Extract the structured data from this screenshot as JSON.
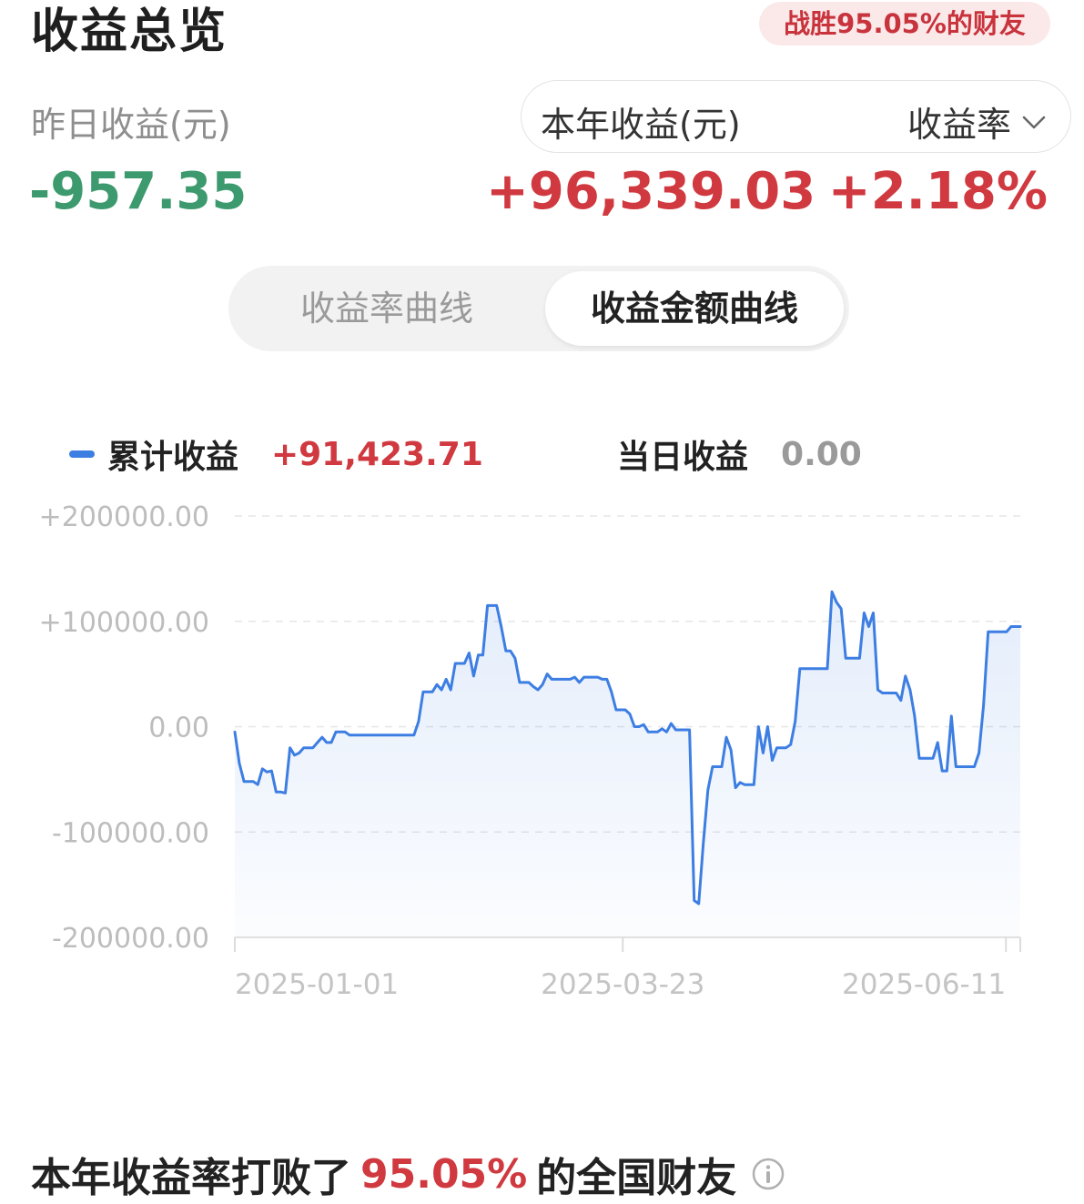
{
  "header": {
    "title": "收益总览",
    "beat_badge": "战胜95.05%的财友"
  },
  "summary": {
    "yesterday_label": "昨日收益(元)",
    "yesterday_value": "-957.35",
    "year_label": "本年收益(元)",
    "year_value": "+96,339.03",
    "rate_select_label": "收益率",
    "rate_value": "+2.18%"
  },
  "tabs": {
    "rate_curve": "收益率曲线",
    "amount_curve": "收益金额曲线",
    "active": "amount_curve"
  },
  "legend": {
    "cumulative_label": "累计收益",
    "cumulative_value": "+91,423.71",
    "daily_label": "当日收益",
    "daily_value": "0.00"
  },
  "colors": {
    "line": "#3d7ee3",
    "positive": "#d0393f",
    "negative": "#3d9a6e"
  },
  "chart_data": {
    "type": "area",
    "ylim": [
      -200000,
      200000
    ],
    "yticks": [
      "+200000.00",
      "+100000.00",
      "0.00",
      "-100000.00",
      "-200000.00"
    ],
    "xticks": [
      "2025-01-01",
      "2025-03-23",
      "2025-06-11"
    ],
    "x_dates": [
      "2025-01-01",
      "2025-06-14"
    ],
    "grid": true,
    "series": [
      {
        "values": [
          -5000,
          -35000,
          -52000,
          -52000,
          -52000,
          -55000,
          -40000,
          -43000,
          -42000,
          -62000,
          -62000,
          -63000,
          -20000,
          -27000,
          -25000,
          -20000,
          -20000,
          -20000,
          -15000,
          -10000,
          -15000,
          -15000,
          -5000,
          -5000,
          -5000,
          -8000,
          -8000,
          -8000,
          -8000,
          -8000,
          -8000,
          -8000,
          -8000,
          -8000,
          -8000,
          -8000,
          -8000,
          -8000,
          -8000,
          -8000,
          5000,
          33000,
          33000,
          33000,
          40000,
          35000,
          45000,
          35000,
          60000,
          60000,
          60000,
          70000,
          48000,
          68000,
          68000,
          115000,
          115000,
          115000,
          95000,
          72000,
          72000,
          65000,
          42000,
          42000,
          42000,
          38000,
          35000,
          40000,
          50000,
          45000,
          45000,
          45000,
          45000,
          45000,
          47000,
          42000,
          47000,
          47000,
          47000,
          47000,
          45000,
          45000,
          33000,
          16000,
          16000,
          16000,
          12000,
          0,
          0,
          2000,
          -5000,
          -5000,
          -5000,
          -2000,
          -5000,
          3000,
          -3000,
          -3000,
          -3000,
          -3000,
          -165000,
          -168000,
          -110000,
          -60000,
          -38000,
          -38000,
          -38000,
          -10000,
          -22000,
          -58000,
          -53000,
          -55000,
          -55000,
          -55000,
          0,
          -25000,
          0,
          -32000,
          -20000,
          -20000,
          -20000,
          -17000,
          5000,
          55000,
          55000,
          55000,
          55000,
          55000,
          55000,
          55000,
          128000,
          118000,
          112000,
          65000,
          65000,
          65000,
          65000,
          108000,
          95000,
          108000,
          35000,
          32000,
          32000,
          32000,
          32000,
          25000,
          48000,
          35000,
          10000,
          -30000,
          -30000,
          -30000,
          -30000,
          -15000,
          -42000,
          -42000,
          10000,
          -38000,
          -38000,
          -38000,
          -38000,
          -38000,
          -25000,
          20000,
          90000,
          90000,
          90000,
          90000,
          90000,
          95000,
          95000,
          95000
        ]
      }
    ]
  },
  "footer": {
    "prefix": "本年收益率打败了",
    "pct": "95.05%",
    "suffix": "的全国财友"
  }
}
